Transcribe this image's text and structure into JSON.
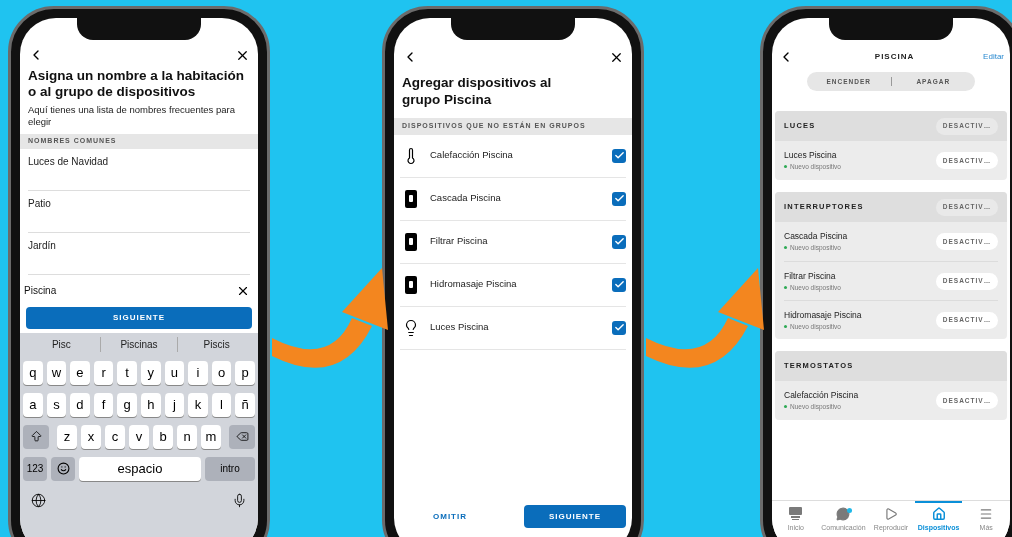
{
  "screen_1": {
    "title": "Asigna un nombre a la habitación o al grupo de dispositivos",
    "subtitle": "Aquí tienes una lista de nombres frecuentes para elegir",
    "section": "NOMBRES COMUNES",
    "options": [
      "Luces de Navidad",
      "Patio",
      "Jardín"
    ],
    "input": {
      "value": "Piscina"
    },
    "button": "SIGUIENTE",
    "suggestions": [
      "Pisc",
      "Piscinas",
      "Piscis"
    ],
    "keyboard": {
      "rows": [
        [
          "q",
          "w",
          "e",
          "r",
          "t",
          "y",
          "u",
          "i",
          "o",
          "p"
        ],
        [
          "a",
          "s",
          "d",
          "f",
          "g",
          "h",
          "j",
          "k",
          "l",
          "ñ"
        ],
        [
          "z",
          "x",
          "c",
          "v",
          "b",
          "n",
          "m"
        ]
      ],
      "numbers": "123",
      "space": "espacio",
      "enter": "intro"
    }
  },
  "screen_2": {
    "title": "Agregar dispositivos al grupo Piscina",
    "section": "DISPOSITIVOS QUE NO ESTÁN EN GRUPOS",
    "devices": [
      {
        "name": "Calefacción Piscina",
        "kind": "thermostat",
        "checked": true
      },
      {
        "name": "Cascada Piscina",
        "kind": "switch",
        "checked": true
      },
      {
        "name": "Filtrar Piscina",
        "kind": "switch",
        "checked": true
      },
      {
        "name": "Hidromasaje Piscina",
        "kind": "switch",
        "checked": true
      },
      {
        "name": "Luces Piscina",
        "kind": "light",
        "checked": true
      }
    ],
    "skip": "OMITIR",
    "next": "SIGUIENTE"
  },
  "screen_3": {
    "title": "PISCINA",
    "edit": "Editar",
    "segments": [
      "ENCENDER",
      "APAGAR"
    ],
    "groups": [
      {
        "title": "LUCES",
        "action": "DESACTIV…",
        "devices": [
          {
            "name": "Luces Piscina",
            "status": "Nuevo dispositivo",
            "action": "DESACTIV…"
          }
        ]
      },
      {
        "title": "INTERRUPTORES",
        "action": "DESACTIV…",
        "devices": [
          {
            "name": "Cascada Piscina",
            "status": "Nuevo dispositivo",
            "action": "DESACTIV…"
          },
          {
            "name": "Filtrar Piscina",
            "status": "Nuevo dispositivo",
            "action": "DESACTIV…"
          },
          {
            "name": "Hidromasaje Piscina",
            "status": "Nuevo dispositivo",
            "action": "DESACTIV…"
          }
        ]
      },
      {
        "title": "TERMOSTATOS",
        "devices": [
          {
            "name": "Calefacción Piscina",
            "status": "Nuevo dispositivo",
            "action": "DESACTIV…"
          }
        ]
      }
    ],
    "tabs": [
      {
        "label": "Inicio",
        "kind": "home",
        "selected": false,
        "notification": false
      },
      {
        "label": "Comunicación",
        "kind": "chat",
        "selected": false,
        "notification": true
      },
      {
        "label": "Reproducir",
        "kind": "play",
        "selected": false,
        "notification": false
      },
      {
        "label": "Dispositivos",
        "kind": "devices",
        "selected": true,
        "notification": false
      },
      {
        "label": "Más",
        "kind": "more",
        "selected": false,
        "notification": false
      }
    ]
  }
}
